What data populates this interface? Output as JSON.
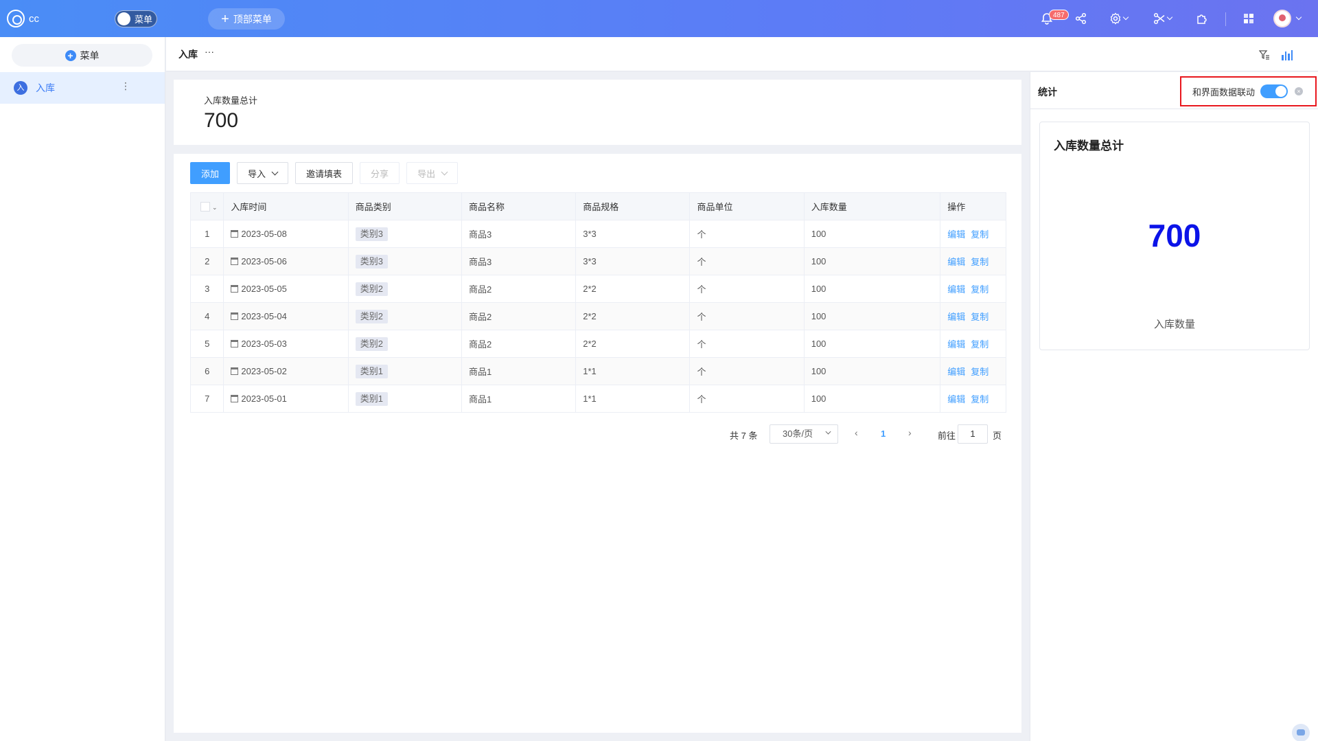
{
  "app": {
    "name": "cc"
  },
  "topbar": {
    "menu_toggle_label": "菜单",
    "top_menu_label": "顶部菜单",
    "notification_count": "487"
  },
  "sidebar": {
    "menu_button_label": "菜单",
    "items": [
      {
        "icon_text": "入",
        "label": "入库",
        "more": "⋮"
      }
    ]
  },
  "page": {
    "title": "入库",
    "more": "···"
  },
  "summary": {
    "label": "入库数量总计",
    "value": "700"
  },
  "toolbar": {
    "add": "添加",
    "import": "导入",
    "invite": "邀请填表",
    "share": "分享",
    "export": "导出"
  },
  "table": {
    "columns": [
      "入库时间",
      "商品类别",
      "商品名称",
      "商品规格",
      "商品单位",
      "入库数量",
      "操作"
    ],
    "rows": [
      {
        "idx": "1",
        "date": "2023-05-08",
        "category": "类别3",
        "name": "商品3",
        "spec": "3*3",
        "unit": "个",
        "qty": "100"
      },
      {
        "idx": "2",
        "date": "2023-05-06",
        "category": "类别3",
        "name": "商品3",
        "spec": "3*3",
        "unit": "个",
        "qty": "100"
      },
      {
        "idx": "3",
        "date": "2023-05-05",
        "category": "类别2",
        "name": "商品2",
        "spec": "2*2",
        "unit": "个",
        "qty": "100"
      },
      {
        "idx": "4",
        "date": "2023-05-04",
        "category": "类别2",
        "name": "商品2",
        "spec": "2*2",
        "unit": "个",
        "qty": "100"
      },
      {
        "idx": "5",
        "date": "2023-05-03",
        "category": "类别2",
        "name": "商品2",
        "spec": "2*2",
        "unit": "个",
        "qty": "100"
      },
      {
        "idx": "6",
        "date": "2023-05-02",
        "category": "类别1",
        "name": "商品1",
        "spec": "1*1",
        "unit": "个",
        "qty": "100"
      },
      {
        "idx": "7",
        "date": "2023-05-01",
        "category": "类别1",
        "name": "商品1",
        "spec": "1*1",
        "unit": "个",
        "qty": "100"
      }
    ],
    "action_edit": "编辑",
    "action_copy": "复制"
  },
  "pagination": {
    "total": "共 7 条",
    "page_size": "30条/页",
    "current": "1",
    "goto_label": "前往",
    "goto_value": "1",
    "page_unit": "页"
  },
  "stats": {
    "title": "统计",
    "linkage_label": "和界面数据联动",
    "linkage_on": true,
    "card": {
      "title": "入库数量总计",
      "value": "700",
      "label": "入库数量"
    }
  },
  "colors": {
    "accent": "#409eff",
    "stat_value": "#0b13e8",
    "highlight_border": "#e8161d"
  }
}
